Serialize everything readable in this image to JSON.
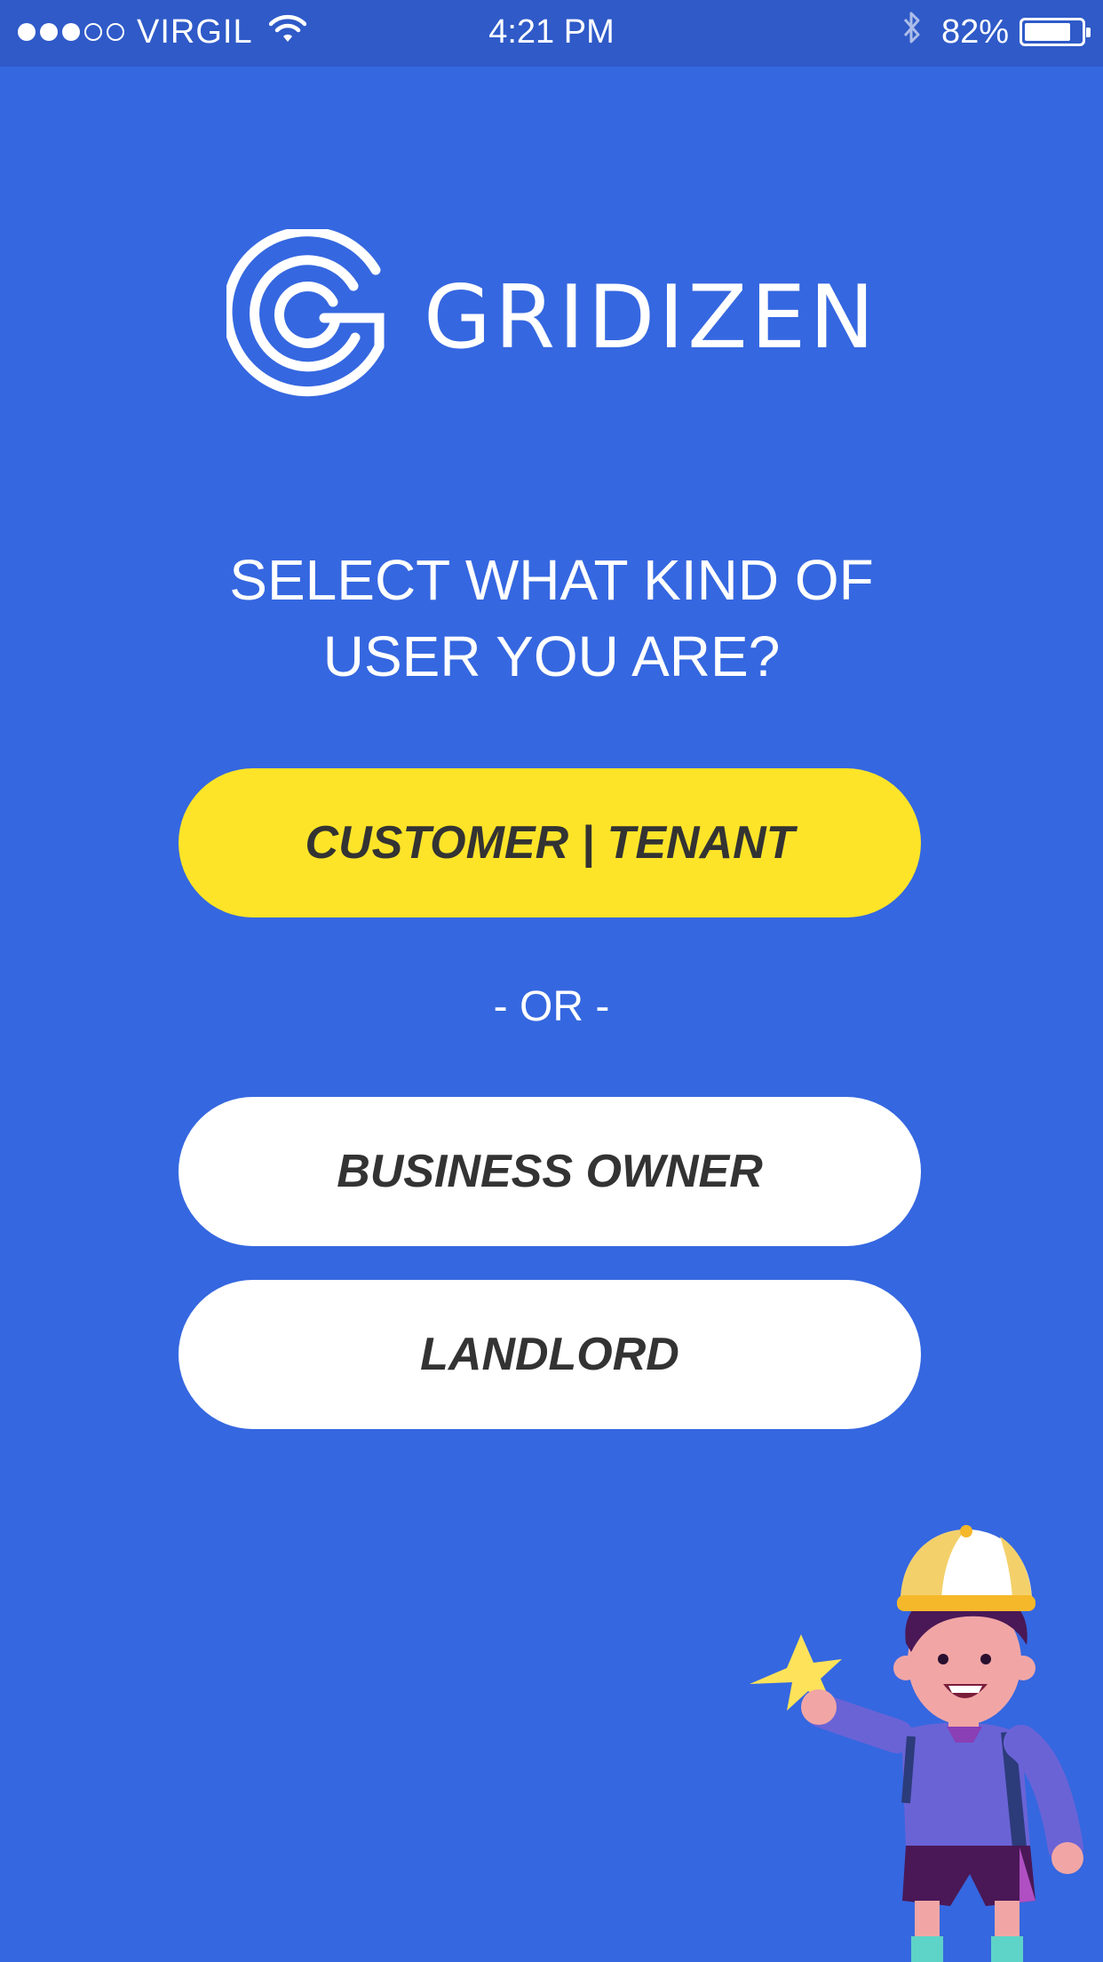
{
  "status_bar": {
    "carrier": "VIRGIL",
    "time": "4:21 PM",
    "battery_percent": "82%",
    "battery_level": 0.82,
    "signal_bars_filled": 3,
    "signal_bars_total": 5
  },
  "logo": {
    "wordmark": "GRIDIZEN"
  },
  "prompt": {
    "text": "SELECT WHAT KIND OF USER YOU ARE?"
  },
  "options": {
    "customer_label": "CUSTOMER | TENANT",
    "or_label": "- OR -",
    "business_label": "BUSINESS OWNER",
    "landlord_label": "LANDLORD"
  },
  "colors": {
    "background": "#3567e0",
    "status_bar": "#2f5ac8",
    "primary_button": "#fde428",
    "secondary_button": "#ffffff",
    "button_text": "#333333"
  },
  "icons": {
    "wifi": "wifi-icon",
    "bluetooth": "bluetooth-icon",
    "battery": "battery-icon",
    "logo_mark": "gridizen-g-logo",
    "mascot": "kid-mascot-illustration"
  }
}
